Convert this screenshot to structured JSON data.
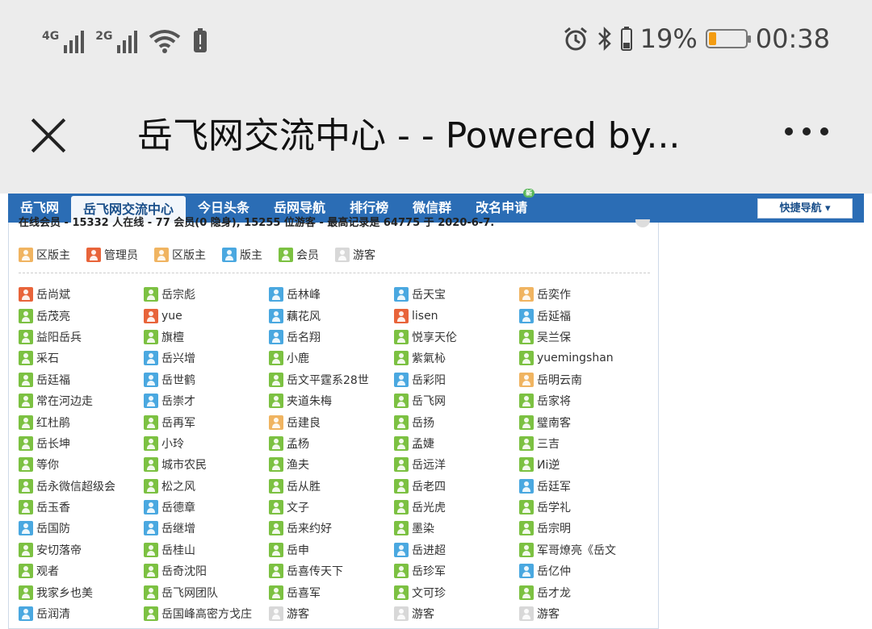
{
  "status_bar": {
    "signal_1_label": "4G",
    "signal_2_label": "2G",
    "battery_percent": "19%",
    "battery_level": 0.19,
    "time": "00:38"
  },
  "title_bar": {
    "title": "岳飞网交流中心 - - Powered by..."
  },
  "nav": {
    "items": [
      "岳飞网",
      "岳飞网交流中心",
      "今日头条",
      "岳网导航",
      "排行榜",
      "微信群",
      "改名申请"
    ],
    "quick_nav": "快捷导航 ▾"
  },
  "online_info": "在线会员 - 15332 人在线 - 77 会员(0 隐身), 15255 位游客 - 最高记录是 64775 于 2020-6-7.",
  "legend": [
    {
      "label": "区版主",
      "color": "orange"
    },
    {
      "label": "管理员",
      "color": "red"
    },
    {
      "label": "区版主",
      "color": "orange"
    },
    {
      "label": "版主",
      "color": "blue"
    },
    {
      "label": "会员",
      "color": "green"
    },
    {
      "label": "游客",
      "color": "grey"
    }
  ],
  "members": [
    {
      "name": "岳尚斌",
      "color": "red"
    },
    {
      "name": "岳宗彪",
      "color": "green"
    },
    {
      "name": "岳林峰",
      "color": "blue"
    },
    {
      "name": "岳天宝",
      "color": "blue"
    },
    {
      "name": "岳奕作",
      "color": "orange"
    },
    {
      "name": "岳茂亮",
      "color": "green"
    },
    {
      "name": "yue",
      "color": "red"
    },
    {
      "name": "藕花风",
      "color": "blue"
    },
    {
      "name": "lisen",
      "color": "red"
    },
    {
      "name": "岳延福",
      "color": "blue"
    },
    {
      "name": "益阳岳兵",
      "color": "green"
    },
    {
      "name": "旗檀",
      "color": "green"
    },
    {
      "name": "岳名翔",
      "color": "blue"
    },
    {
      "name": "悦享天伦",
      "color": "green"
    },
    {
      "name": "吴兰保",
      "color": "green"
    },
    {
      "name": "采石",
      "color": "green"
    },
    {
      "name": "岳兴增",
      "color": "blue"
    },
    {
      "name": "小鹿",
      "color": "green"
    },
    {
      "name": "紫氣杺",
      "color": "green"
    },
    {
      "name": "yuemingshan",
      "color": "green"
    },
    {
      "name": "岳廷福",
      "color": "green"
    },
    {
      "name": "岳世鹤",
      "color": "blue"
    },
    {
      "name": "岳文平霆系28世",
      "color": "green"
    },
    {
      "name": "岳彩阳",
      "color": "blue"
    },
    {
      "name": "岳明云南",
      "color": "orange"
    },
    {
      "name": "常在河边走",
      "color": "green"
    },
    {
      "name": "岳崇才",
      "color": "blue"
    },
    {
      "name": "夹道朱梅",
      "color": "green"
    },
    {
      "name": "岳飞网",
      "color": "green"
    },
    {
      "name": "岳家将",
      "color": "green"
    },
    {
      "name": "红杜鹃",
      "color": "green"
    },
    {
      "name": "岳再军",
      "color": "green"
    },
    {
      "name": "岳建良",
      "color": "orange"
    },
    {
      "name": "岳扬",
      "color": "green"
    },
    {
      "name": "璧南客",
      "color": "green"
    },
    {
      "name": "岳长坤",
      "color": "green"
    },
    {
      "name": "小玲",
      "color": "green"
    },
    {
      "name": "孟杨",
      "color": "green"
    },
    {
      "name": "孟婕",
      "color": "green"
    },
    {
      "name": "三吉",
      "color": "green"
    },
    {
      "name": "等你",
      "color": "green"
    },
    {
      "name": "城市农民",
      "color": "green"
    },
    {
      "name": "渔夫",
      "color": "green"
    },
    {
      "name": "岳远洋",
      "color": "green"
    },
    {
      "name": "Иi逆",
      "color": "green"
    },
    {
      "name": "岳永微信超级会",
      "color": "green"
    },
    {
      "name": "松之风",
      "color": "green"
    },
    {
      "name": "岳从胜",
      "color": "green"
    },
    {
      "name": "岳老四",
      "color": "green"
    },
    {
      "name": "岳廷军",
      "color": "blue"
    },
    {
      "name": "岳玉香",
      "color": "green"
    },
    {
      "name": "岳德章",
      "color": "blue"
    },
    {
      "name": "文子",
      "color": "green"
    },
    {
      "name": "岳光虎",
      "color": "green"
    },
    {
      "name": "岳学礼",
      "color": "green"
    },
    {
      "name": "岳国防",
      "color": "blue"
    },
    {
      "name": "岳继增",
      "color": "blue"
    },
    {
      "name": "岳来约好",
      "color": "green"
    },
    {
      "name": "墨染",
      "color": "green"
    },
    {
      "name": "岳宗明",
      "color": "green"
    },
    {
      "name": "安切落帝",
      "color": "green"
    },
    {
      "name": "岳桂山",
      "color": "green"
    },
    {
      "name": "岳申",
      "color": "green"
    },
    {
      "name": "岳进超",
      "color": "blue"
    },
    {
      "name": "军哥燎亮《岳文",
      "color": "green"
    },
    {
      "name": "观者",
      "color": "green"
    },
    {
      "name": "岳奇沈阳",
      "color": "green"
    },
    {
      "name": "岳喜传天下",
      "color": "green"
    },
    {
      "name": "岳珍军",
      "color": "green"
    },
    {
      "name": "岳亿仲",
      "color": "blue"
    },
    {
      "name": "我家乡也美",
      "color": "green"
    },
    {
      "name": "岳飞网团队",
      "color": "green"
    },
    {
      "name": "岳喜军",
      "color": "green"
    },
    {
      "name": "文可珍",
      "color": "green"
    },
    {
      "name": "岳才龙",
      "color": "green"
    },
    {
      "name": "岳润清",
      "color": "blue"
    },
    {
      "name": "岳国峰高密方戈庄",
      "color": "green"
    },
    {
      "name": "游客",
      "color": "grey"
    },
    {
      "name": "游客",
      "color": "grey"
    },
    {
      "name": "游客",
      "color": "grey"
    }
  ]
}
